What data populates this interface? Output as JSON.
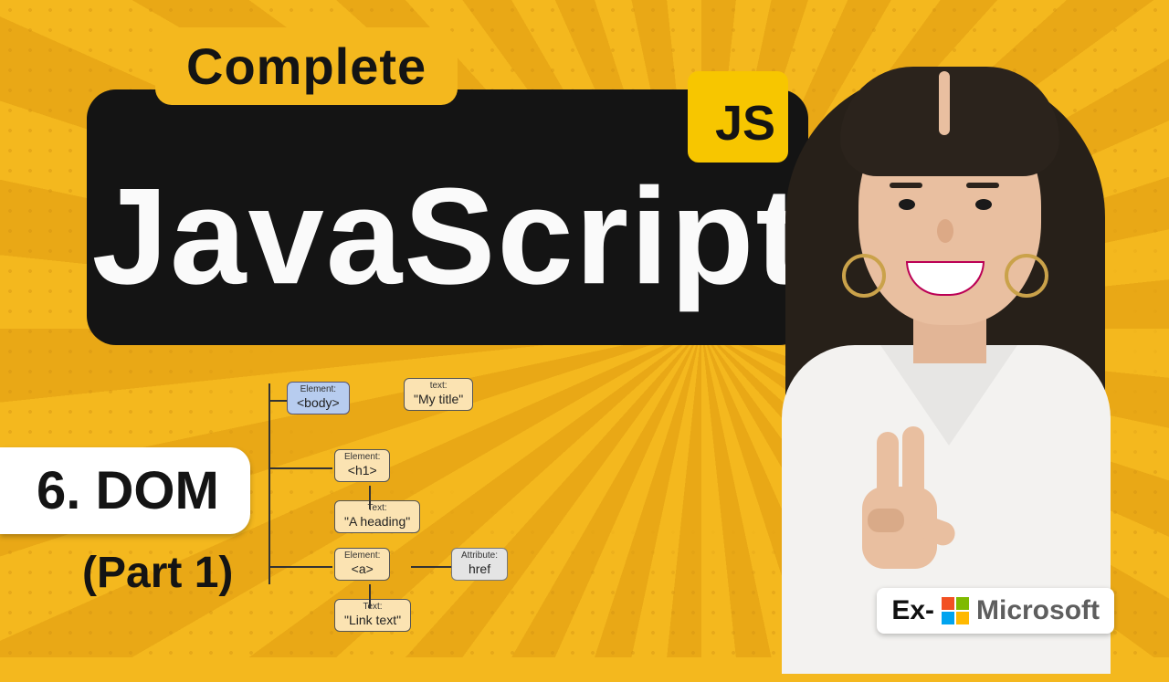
{
  "badge": {
    "complete": "Complete",
    "js": "JS"
  },
  "title": "JavaScript",
  "chapter": {
    "label": "6. DOM",
    "part": "(Part 1)"
  },
  "dom_tree": {
    "body": {
      "type": "Element:",
      "value": "<body>"
    },
    "mytitle": {
      "type": "text:",
      "value": "\"My title\""
    },
    "h1": {
      "type": "Element:",
      "value": "<h1>"
    },
    "heading": {
      "type": "Text:",
      "value": "\"A heading\""
    },
    "a": {
      "type": "Element:",
      "value": "<a>"
    },
    "href": {
      "type": "Attribute:",
      "value": "href"
    },
    "linktext": {
      "type": "Text:",
      "value": "\"Link text\""
    }
  },
  "ms": {
    "prefix": "Ex-",
    "name": "Microsoft"
  }
}
